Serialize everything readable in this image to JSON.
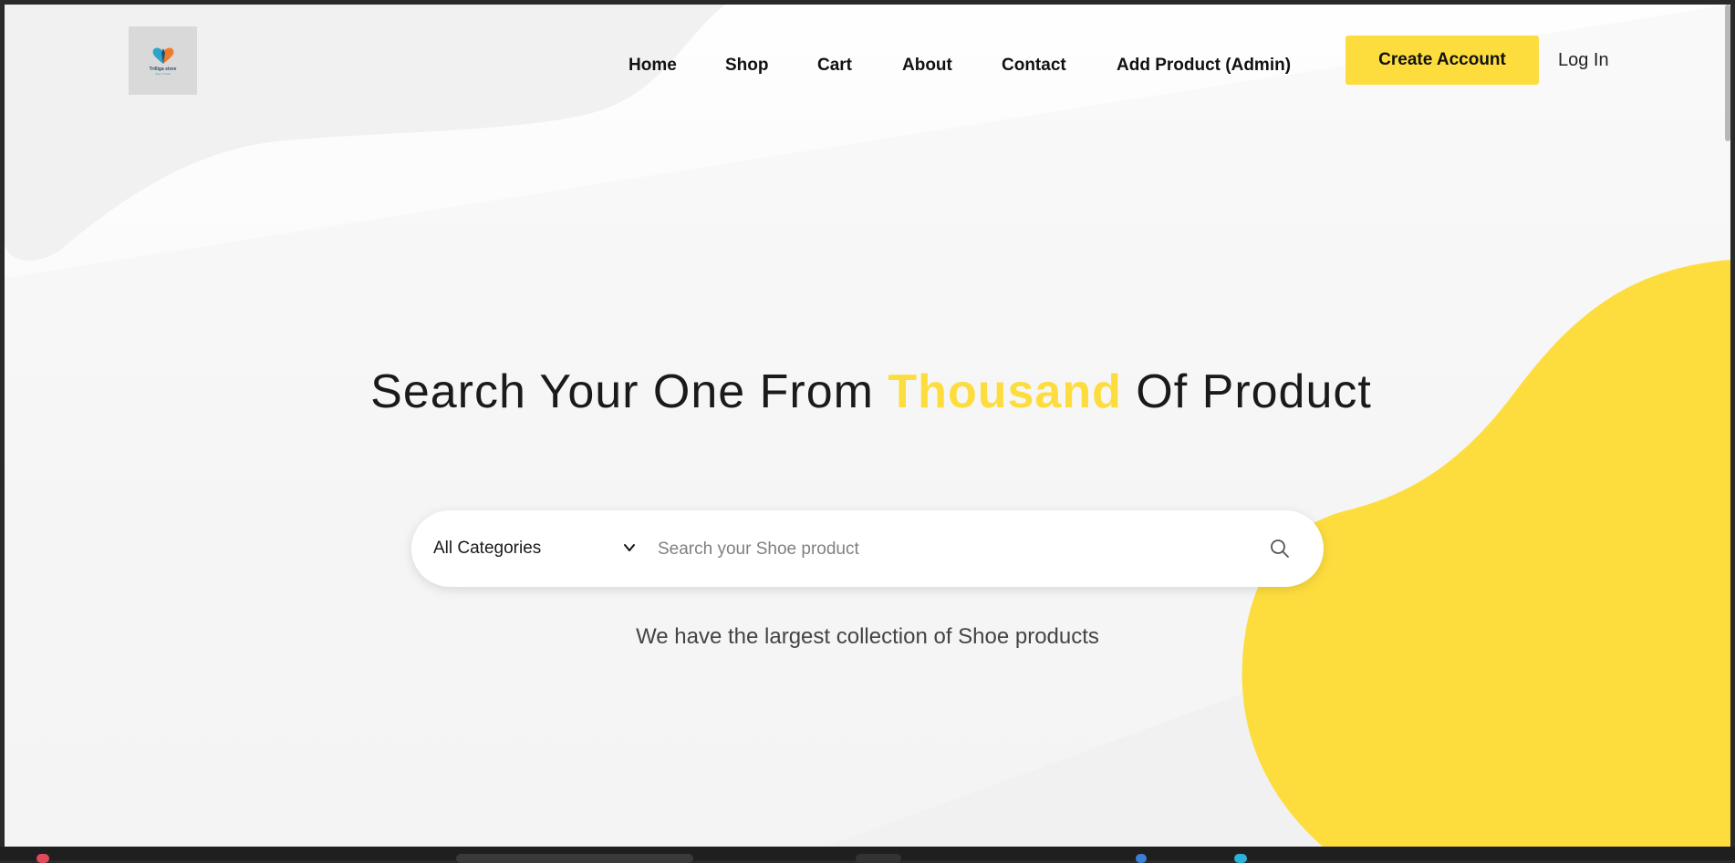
{
  "brand": {
    "logo_name": "Trilliga store",
    "logo_tagline": "Step in Style"
  },
  "nav": {
    "items": [
      {
        "label": "Home"
      },
      {
        "label": "Shop"
      },
      {
        "label": "Cart"
      },
      {
        "label": "About"
      },
      {
        "label": "Contact"
      },
      {
        "label": "Add Product (Admin)"
      }
    ],
    "create_account_label": "Create Account",
    "login_label": "Log In"
  },
  "hero": {
    "title_before": "Search Your One From ",
    "title_accent": "Thousand",
    "title_after": " Of Product",
    "subtitle": "We have the largest collection of Shoe products"
  },
  "search": {
    "category_selected": "All Categories",
    "placeholder": "Search your Shoe product",
    "value": ""
  },
  "colors": {
    "accent": "#fddd3e",
    "text": "#111111",
    "background": "#f8f8f8"
  },
  "icons": {
    "search": "search-icon",
    "chevron": "chevron-down-icon"
  }
}
